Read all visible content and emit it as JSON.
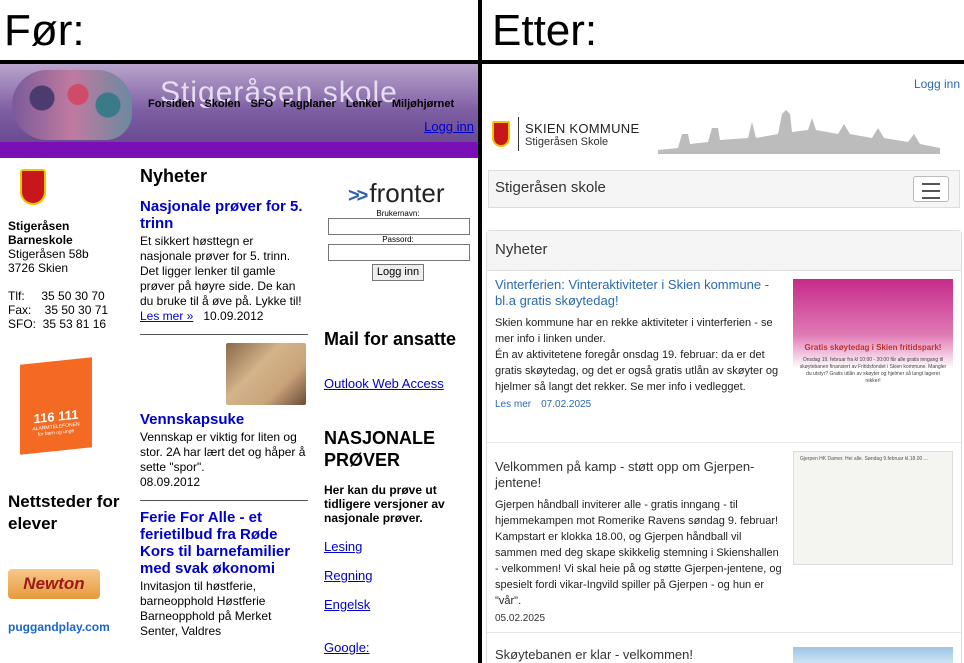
{
  "headers": {
    "before": "Før:",
    "after": "Etter:"
  },
  "old_site": {
    "title": "Stigeråsen skole",
    "nav": [
      "Forsiden",
      "Skolen",
      "SFO",
      "Fagplaner",
      "Lenker",
      "Miljøhjørnet"
    ],
    "login_link": "Logg inn",
    "contact": {
      "name": "Stigeråsen Barneskole",
      "street": "Stigeråsen 58b",
      "city": "3726 Skien",
      "phones": "Tlf:     35 50 30 70\nFax:    35 50 30 71\nSFO:  35 53 81 16"
    },
    "alarm": {
      "number": "116 111",
      "line1": "ALARMTELEFONEN",
      "line2": "for barn og unge"
    },
    "nettsteder_heading": "Nettsteder for elever",
    "newton_logo": "Newton",
    "puggandplay_logo": "puggandplay.com",
    "news_heading": "Nyheter",
    "news": [
      {
        "title": "Nasjonale prøver for 5. trinn",
        "body": "Et sikkert høsttegn er nasjonale prøver for 5. trinn. Det ligger lenker til gamle prøver på høyre side. De kan du bruke til å øve på. Lykke til!",
        "more": "Les mer »",
        "date": "10.09.2012"
      },
      {
        "title": "Vennskapsuke",
        "body": "Vennskap er viktig for liten og stor. 2A har lært det og håper å sette \"spor\".",
        "date": "08.09.2012"
      },
      {
        "title": "Ferie For Alle - et ferietilbud fra Røde Kors til barnefamilier med svak økonomi",
        "body": "Invitasjon til høstferie, barneopphold Høstferie Barneopphold på Merket Senter, Valdres"
      }
    ],
    "fronter": {
      "logo": "fronter",
      "user_label": "Brukernavn:",
      "pass_label": "Passord:",
      "button": "Logg inn"
    },
    "mail_heading": "Mail for ansatte",
    "outlook_link": "Outlook Web Access",
    "nasjonale_heading": "NASJONALE PRØVER",
    "nasjonale_text": "Her kan du prøve ut tidligere versjoner av nasjonale prøver.",
    "subjects": [
      "Lesing",
      "Regning",
      "Engelsk"
    ],
    "google_label": "Google:"
  },
  "new_site": {
    "login_link": "Logg inn",
    "logo_title": "SKIEN KOMMUNE",
    "logo_sub": "Stigeråsen Skole",
    "brand": "Stigeråsen skole",
    "news_heading": "Nyheter",
    "news": [
      {
        "title": "Vinterferien: Vinteraktiviteter i Skien kommune - bl.a gratis skøytedag!",
        "body": "Skien kommune har en rekke aktiviteter i vinterferien - se mer info i linken under.\nÉn av aktivitetene foregår onsdag 19. februar: da er det gratis skøytedag, og det er også gratis utlån av skøyter og hjelmer så langt det rekker. Se mer info i vedlegget.",
        "more": "Les mer",
        "date": "07.02.2025",
        "img_caption": "Gratis skøytedag i Skien fritidspark!",
        "img_sub": "Onsdag 19. februar fra kl 10:00 - 20:00 får alle gratis inngang til skøytebanen finansiert av Fritidsfondet i Skien kommune. Mangler du utstyr? Gratis utlån av skøyter og hjelmer så langt lageret rekker!"
      },
      {
        "title": "Velkommen på kamp - støtt opp om Gjerpen-jentene!",
        "body": "Gjerpen håndball inviterer alle - gratis inngang - til hjemmekampen mot Romerike Ravens søndag 9. februar! Kampstart er klokka 18.00, og Gjerpen håndball vil sammen med deg skape skikkelig stemning i Skienshallen - velkommen! Vi skal heie på og støtte Gjerpen-jentene, og spesielt fordi vikar-Ingvild spiller på Gjerpen - og hun er \"vår\".",
        "date": "05.02.2025",
        "img_text": "Gjerpen HK Damer. Hei alle. Søndag 9.februar kl.18.00 ..."
      },
      {
        "title": "Skøytebanen er klar - velkommen!"
      }
    ]
  }
}
